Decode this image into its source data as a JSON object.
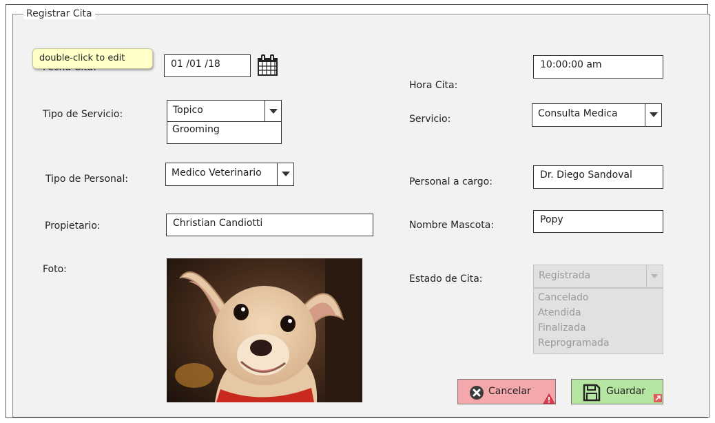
{
  "form": {
    "legend": "Registrar Cita",
    "tooltip": "double-click to edit",
    "fecha": {
      "label": "Fecha Cita:",
      "value": "01 /01 /18"
    },
    "hora": {
      "label": "Hora Cita:",
      "value": "10:00:00 am"
    },
    "tipo_servicio": {
      "label": "Tipo de Servicio:",
      "selected": "Topico",
      "options": [
        "Grooming"
      ]
    },
    "servicio": {
      "label": "Servicio:",
      "selected": "Consulta Medica"
    },
    "tipo_personal": {
      "label": "Tipo de Personal:",
      "selected": "Medico Veterinario"
    },
    "personal_cargo": {
      "label": "Personal a cargo:",
      "value": "Dr. Diego Sandoval"
    },
    "propietario": {
      "label": "Propietario:",
      "value": "Christian Candiotti"
    },
    "mascota": {
      "label": "Nombre Mascota:",
      "value": "Popy"
    },
    "foto": {
      "label": "Foto:"
    },
    "estado": {
      "label": "Estado de Cita:",
      "selected": "Registrada",
      "options": [
        "Cancelado",
        "Atendida",
        "Finalizada",
        "Reprogramada"
      ]
    }
  },
  "buttons": {
    "cancel_label": "Cancelar",
    "save_label": "Guardar"
  },
  "colors": {
    "cancel_bg": "#f4a8ac",
    "save_bg": "#b5e6a1",
    "tooltip_bg": "#ffffc8"
  }
}
